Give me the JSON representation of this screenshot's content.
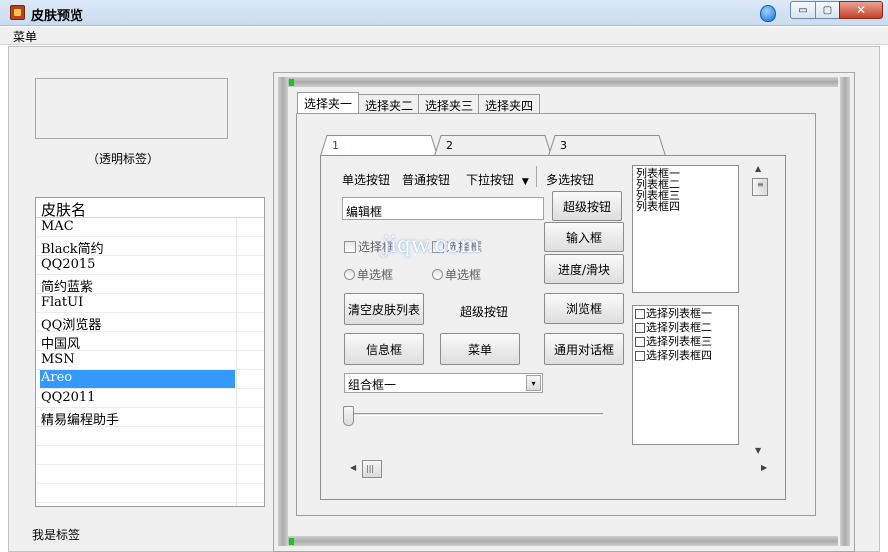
{
  "window": {
    "title": "皮肤预览",
    "menu": "菜单",
    "close_glyph": "✕",
    "min_glyph": "▭",
    "max_glyph": "▢"
  },
  "left": {
    "transparent_label": "（透明标签）",
    "list_header": "皮肤名",
    "skins": [
      "MAC",
      "Black简约",
      "QQ2015",
      "简约蓝紫",
      "FlatUI",
      "QQ浏览器",
      "中国风",
      "MSN",
      "Areo",
      "QQ2011",
      "精易编程助手"
    ],
    "selected_skin": "Areo",
    "bottom_label": "我是标签"
  },
  "outer_tabs": [
    "选择夹一",
    "选择夹二",
    "选择夹三",
    "选择夹四"
  ],
  "inner_tabs": [
    "1",
    "2",
    "3"
  ],
  "controls": {
    "radio_button_label": "单选按钮",
    "normal_button_label": "普通按钮",
    "dropdown_button_label": "下拉按钮",
    "dropdown_arrow": "▼",
    "multi_select_label": "多选按钮",
    "edit_box_value": "编辑框",
    "super_button_1": "超级按钮",
    "input_box": "输入框",
    "checkbox_1": "选择框",
    "checkbox_2": "选择框",
    "radio_1": "单选框",
    "radio_2": "单选框",
    "progress_slider": "进度/滑块",
    "clear_skin_list": "清空皮肤列表",
    "super_button_2": "超级按钮",
    "browse_box": "浏览框",
    "info_box": "信息框",
    "menu_button": "菜单",
    "common_dialog": "通用对话框",
    "combo_value": "组合框一",
    "combo_arrow": "▾"
  },
  "list_box_items": [
    "列表框一",
    "列表框二",
    "列表框三",
    "列表框四"
  ],
  "check_list_items": [
    "选择列表框一",
    "选择列表框二",
    "选择列表框三",
    "选择列表框四"
  ],
  "scroll": {
    "up": "▲",
    "down": "▼",
    "left": "◀",
    "right": "▶",
    "grip_v": "≡",
    "grip_h": "|||"
  },
  "watermark": "jiqw.com"
}
